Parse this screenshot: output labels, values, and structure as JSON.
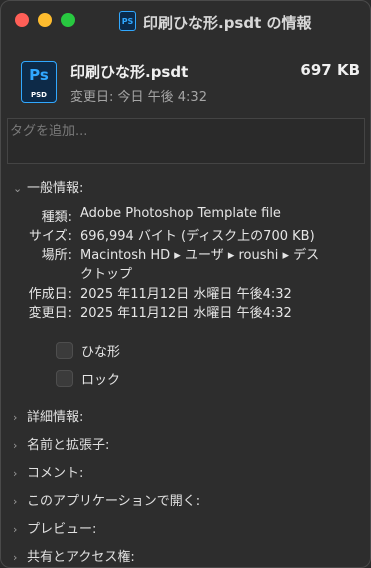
{
  "window": {
    "title": "印刷ひな形.psdt の情報",
    "title_icon": "PS"
  },
  "header": {
    "icon_label_top": "Ps",
    "icon_label_bottom": "PSD",
    "filename": "印刷ひな形.psdt",
    "size": "697 KB",
    "modified": "変更日: 今日 午後 4:32"
  },
  "tags": {
    "placeholder": "タグを追加..."
  },
  "general": {
    "header": "一般情報:",
    "rows": [
      {
        "key": "種類:",
        "value": "Adobe Photoshop Template file"
      },
      {
        "key": "サイズ:",
        "value": "696,994 バイト (ディスク上の700 KB)"
      },
      {
        "key": "場所:",
        "value": "Macintosh HD ▸ ユーザ ▸ roushi ▸ デス"
      },
      {
        "key": "",
        "value": "クトップ"
      },
      {
        "key": "作成日:",
        "value": "2025 年11月12日 水曜日 午後4:32"
      },
      {
        "key": "変更日:",
        "value": "2025 年11月12日 水曜日 午後4:32"
      }
    ],
    "checkboxes": [
      {
        "label": "ひな形",
        "checked": false
      },
      {
        "label": "ロック",
        "checked": false
      }
    ]
  },
  "sections": [
    {
      "label": "詳細情報:"
    },
    {
      "label": "名前と拡張子:"
    },
    {
      "label": "コメント:"
    },
    {
      "label": "このアプリケーションで開く:"
    },
    {
      "label": "プレビュー:"
    },
    {
      "label": "共有とアクセス権:"
    }
  ]
}
